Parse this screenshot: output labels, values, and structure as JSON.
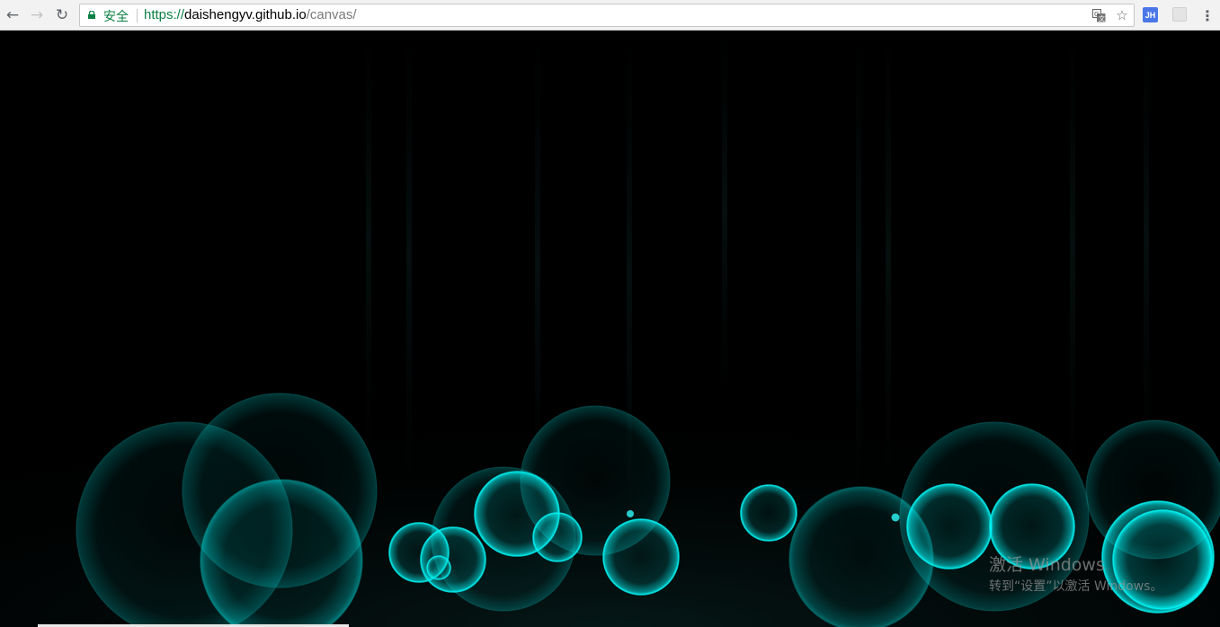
{
  "browser": {
    "security_label": "安全",
    "url": {
      "scheme": "https://",
      "host": "daishengyv.github.io",
      "path": "/canvas/"
    },
    "icons": {
      "back": "back-arrow-icon",
      "forward": "forward-arrow-icon",
      "reload": "reload-icon",
      "lock": "lock-icon",
      "translate": "translate-icon",
      "bookmark": "star-icon",
      "extension_1": "jh-extension-icon",
      "extension_2": "extension-icon",
      "menu": "kebab-menu-icon"
    },
    "extension_1_label": "JH"
  },
  "canvas": {
    "background": "#000000",
    "accent": "#00e5e5"
  },
  "watermark": {
    "title": "激活 Windows",
    "subtitle": "转到“设置”以激活 Windows。"
  }
}
